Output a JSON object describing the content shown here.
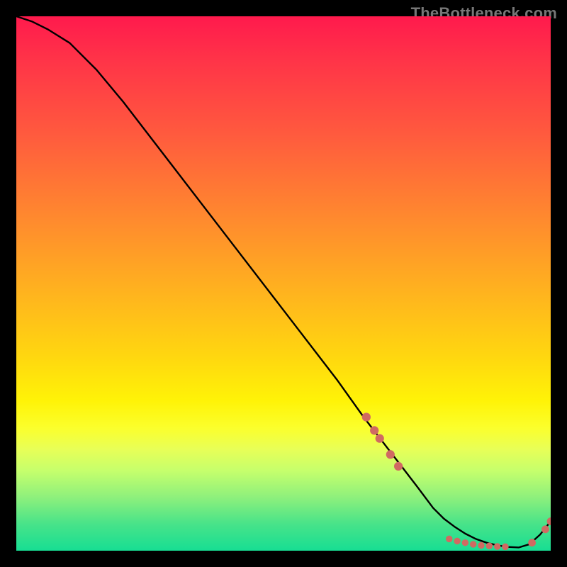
{
  "watermark": "TheBottleneck.com",
  "chart_data": {
    "type": "line",
    "title": "",
    "xlabel": "",
    "ylabel": "",
    "xlim": [
      0,
      100
    ],
    "ylim": [
      0,
      100
    ],
    "grid": false,
    "curve": {
      "name": "bottleneck-curve",
      "x": [
        0,
        3,
        6,
        10,
        15,
        20,
        30,
        40,
        50,
        60,
        65,
        70,
        75,
        78,
        80,
        82,
        84,
        86,
        88,
        90,
        92,
        94,
        96,
        98,
        100
      ],
      "y": [
        100,
        99,
        97.5,
        95,
        90,
        84,
        71,
        58,
        45,
        32,
        25,
        18.5,
        12,
        8,
        6,
        4.5,
        3.2,
        2.2,
        1.5,
        1.0,
        0.7,
        0.6,
        1.2,
        3.0,
        5.5
      ]
    },
    "point_overlays": [
      {
        "x": 65.5,
        "y": 25.0,
        "r": 0.9
      },
      {
        "x": 67.0,
        "y": 22.5,
        "r": 0.9
      },
      {
        "x": 68.0,
        "y": 21.0,
        "r": 0.9
      },
      {
        "x": 70.0,
        "y": 18.0,
        "r": 0.9
      },
      {
        "x": 71.5,
        "y": 15.8,
        "r": 0.9
      },
      {
        "x": 81.0,
        "y": 2.2,
        "r": 0.7
      },
      {
        "x": 82.5,
        "y": 1.8,
        "r": 0.7
      },
      {
        "x": 84.0,
        "y": 1.5,
        "r": 0.7
      },
      {
        "x": 85.5,
        "y": 1.2,
        "r": 0.7
      },
      {
        "x": 87.0,
        "y": 1.0,
        "r": 0.7
      },
      {
        "x": 88.5,
        "y": 0.9,
        "r": 0.7
      },
      {
        "x": 90.0,
        "y": 0.8,
        "r": 0.7
      },
      {
        "x": 91.5,
        "y": 0.75,
        "r": 0.7
      },
      {
        "x": 96.5,
        "y": 1.5,
        "r": 0.8
      },
      {
        "x": 99.0,
        "y": 4.0,
        "r": 0.8
      },
      {
        "x": 100.0,
        "y": 5.5,
        "r": 0.8
      }
    ],
    "colors": {
      "curve_stroke": "#000000",
      "point_fill": "#d06a62"
    },
    "background_gradient_stops": [
      {
        "pos": 0.0,
        "hex": "#ff1a4d"
      },
      {
        "pos": 0.22,
        "hex": "#ff5a3e"
      },
      {
        "pos": 0.52,
        "hex": "#ffb41e"
      },
      {
        "pos": 0.72,
        "hex": "#fff307"
      },
      {
        "pos": 0.85,
        "hex": "#c6ff6c"
      },
      {
        "pos": 1.0,
        "hex": "#17de93"
      }
    ]
  }
}
